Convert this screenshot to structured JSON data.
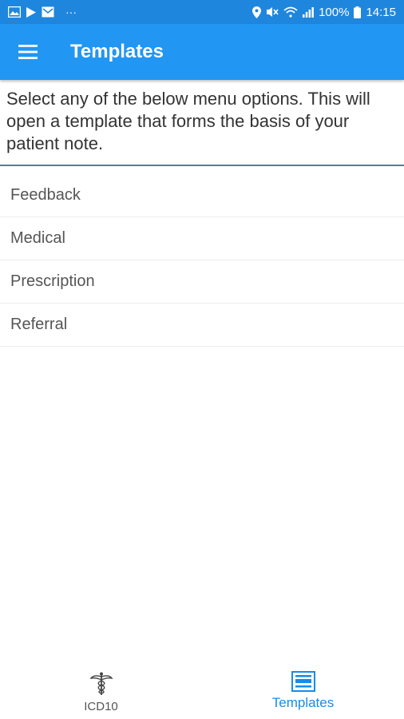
{
  "status_bar": {
    "battery": "100%",
    "time": "14:15",
    "more": "···",
    "left_icons": [
      "gallery-icon",
      "play-store-icon",
      "mail-icon"
    ],
    "right_icons": [
      "location-icon",
      "mute-icon",
      "wifi-icon",
      "signal-icon",
      "battery-icon"
    ]
  },
  "app_bar": {
    "title": "Templates",
    "menu_icon": "hamburger-menu-icon",
    "color": "#2196f3"
  },
  "intro": {
    "text": "Select any of the below menu options. This will open a template that forms the basis of your patient note."
  },
  "menu": {
    "items": [
      {
        "label": "Feedback"
      },
      {
        "label": "Medical"
      },
      {
        "label": "Prescription"
      },
      {
        "label": "Referral"
      }
    ]
  },
  "bottom_nav": {
    "tabs": [
      {
        "label": "ICD10",
        "icon": "caduceus-icon",
        "active": false
      },
      {
        "label": "Templates",
        "icon": "template-icon",
        "active": true
      }
    ],
    "active_color": "#1a8ae6"
  }
}
